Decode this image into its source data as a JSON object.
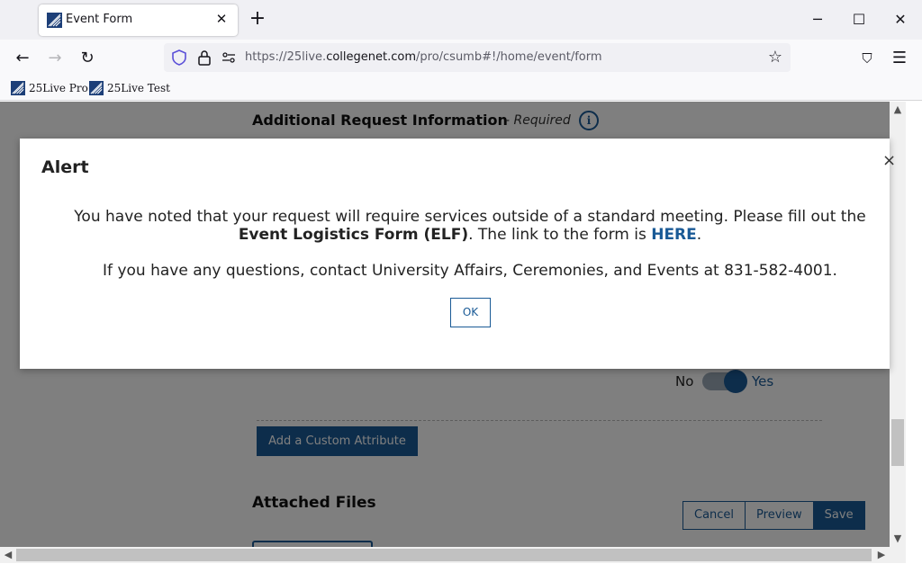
{
  "browser": {
    "tab_title": "Event Form",
    "url_host_prefix": "https://25live.",
    "url_host": "collegenet.com",
    "url_path": "/pro/csumb#!/home/event/form",
    "bookmarks": [
      "25Live Pro",
      "25Live Test"
    ]
  },
  "page": {
    "section_title": "Additional Request Information",
    "section_required": "- Required",
    "toggle_no": "No",
    "toggle_yes": "Yes",
    "toggle_value": "Yes",
    "custom_attribute_button": "Add a Custom Attribute",
    "attached_files_title": "Attached Files",
    "actions": {
      "cancel": "Cancel",
      "preview": "Preview",
      "save": "Save"
    }
  },
  "modal": {
    "title": "Alert",
    "close": "×",
    "message_part1": "You have noted that your request will require services outside of a standard meeting. Please fill out the",
    "message_bold": "Event Logistics Form (ELF)",
    "message_part2": ". The link to the form is ",
    "message_link": "HERE",
    "message_part3": ".",
    "message_contact": "If you have any questions, contact University Affairs, Ceremonies, and Events at 831-582-4001.",
    "ok_label": "OK"
  },
  "colors": {
    "accent": "#1a5a96",
    "overlay": "rgba(0,0,0,0.5)"
  }
}
